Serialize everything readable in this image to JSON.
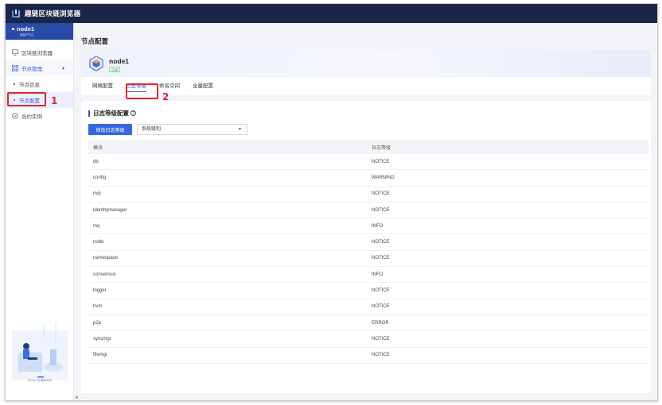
{
  "app": {
    "title": "趣链区块链浏览器"
  },
  "sidebar": {
    "node": {
      "name": "node1",
      "subtitle": "超级IP节点"
    },
    "items": [
      {
        "label": "区块链浏览器",
        "icon": "monitor-icon"
      },
      {
        "label": "节点管理",
        "icon": "node-manage-icon",
        "expanded": true
      },
      {
        "label": "节点信息"
      },
      {
        "label": "节点配置",
        "active": true
      },
      {
        "label": "合约实例",
        "icon": "contract-icon"
      }
    ],
    "footer_text": "Design by 趣链科技"
  },
  "annotations": {
    "step1": "1",
    "step2": "2"
  },
  "page": {
    "title": "节点配置"
  },
  "node_card": {
    "name": "node1",
    "status": "正常"
  },
  "tabs": [
    {
      "label": "网络配置"
    },
    {
      "label": "日志等级",
      "active": true
    },
    {
      "label": "命名空间"
    },
    {
      "label": "全量配置"
    }
  ],
  "log_config": {
    "section_title": "日志等级配置",
    "help_symbol": "?",
    "modify_button": "修改日志等级",
    "select_value": "系统级别",
    "columns": {
      "module": "模块",
      "level": "日志等级"
    },
    "rows": [
      {
        "module": "db",
        "level": "NOTICE"
      },
      {
        "module": "config",
        "level": "WARNING"
      },
      {
        "module": "nvp",
        "level": "NOTICE"
      },
      {
        "module": "identitymanager",
        "level": "NOTICE"
      },
      {
        "module": "mq",
        "level": "INFO"
      },
      {
        "module": "node",
        "level": "NOTICE"
      },
      {
        "module": "namespace",
        "level": "NOTICE"
      },
      {
        "module": "consensus",
        "level": "INFO"
      },
      {
        "module": "logger",
        "level": "NOTICE"
      },
      {
        "module": "hvm",
        "level": "NOTICE"
      },
      {
        "module": "p2p",
        "level": "ERROR"
      },
      {
        "module": "syncmgr",
        "level": "NOTICE"
      },
      {
        "module": "filemgr",
        "level": "NOTICE"
      }
    ]
  },
  "colors": {
    "topbar": "#1b2546",
    "accent": "#2f55d4",
    "annotation": "#e0262e",
    "status_ok": "#2ca34a"
  }
}
